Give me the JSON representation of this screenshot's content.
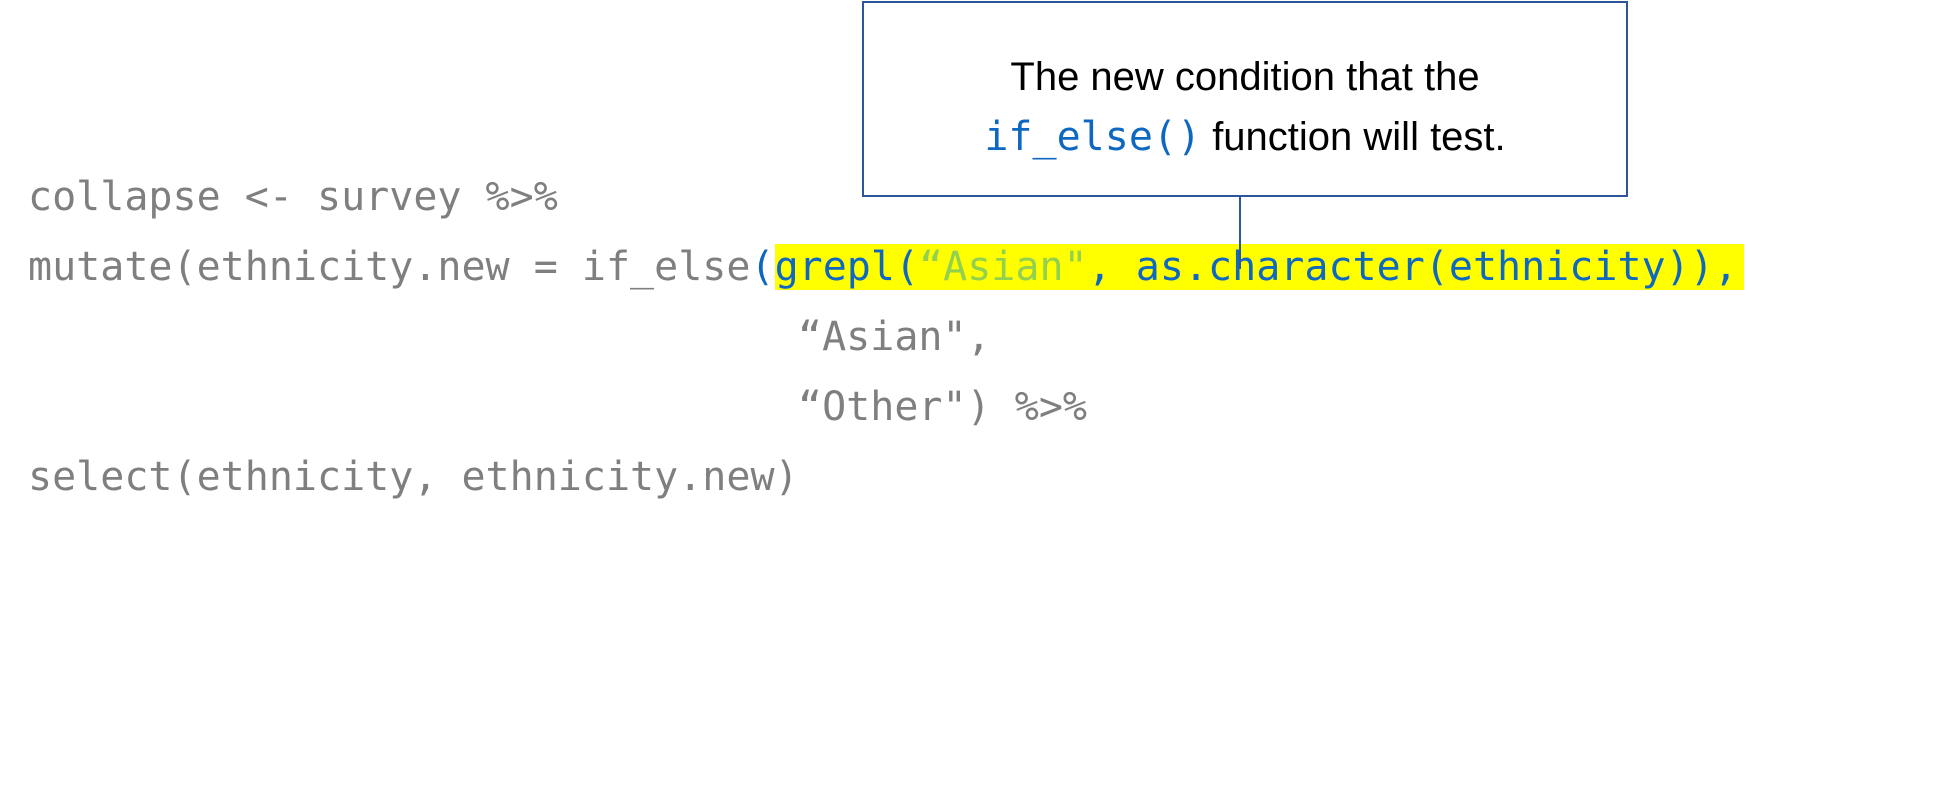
{
  "code": {
    "line1": "collapse <- survey %>%",
    "line2_prefix": "mutate(ethnicity.new = if_else",
    "line2_open_paren": "(",
    "line2_hl_func": "grepl(",
    "line2_hl_string": "“Asian\"",
    "line2_hl_rest": ", as.character(ethnicity)),",
    "line3": "“Asian\",",
    "line4": "“Other\") %>%",
    "line5": "select(ethnicity, ethnicity.new)"
  },
  "callout": {
    "line1": "The new condition that the",
    "code_text": "if_else()",
    "line2_rest": " function will test."
  },
  "colors": {
    "code_gray": "#7f7f7f",
    "highlight_yellow": "#ffff00",
    "code_blue": "#0e67c1",
    "string_green": "#92d050",
    "callout_border": "#2e5597"
  }
}
